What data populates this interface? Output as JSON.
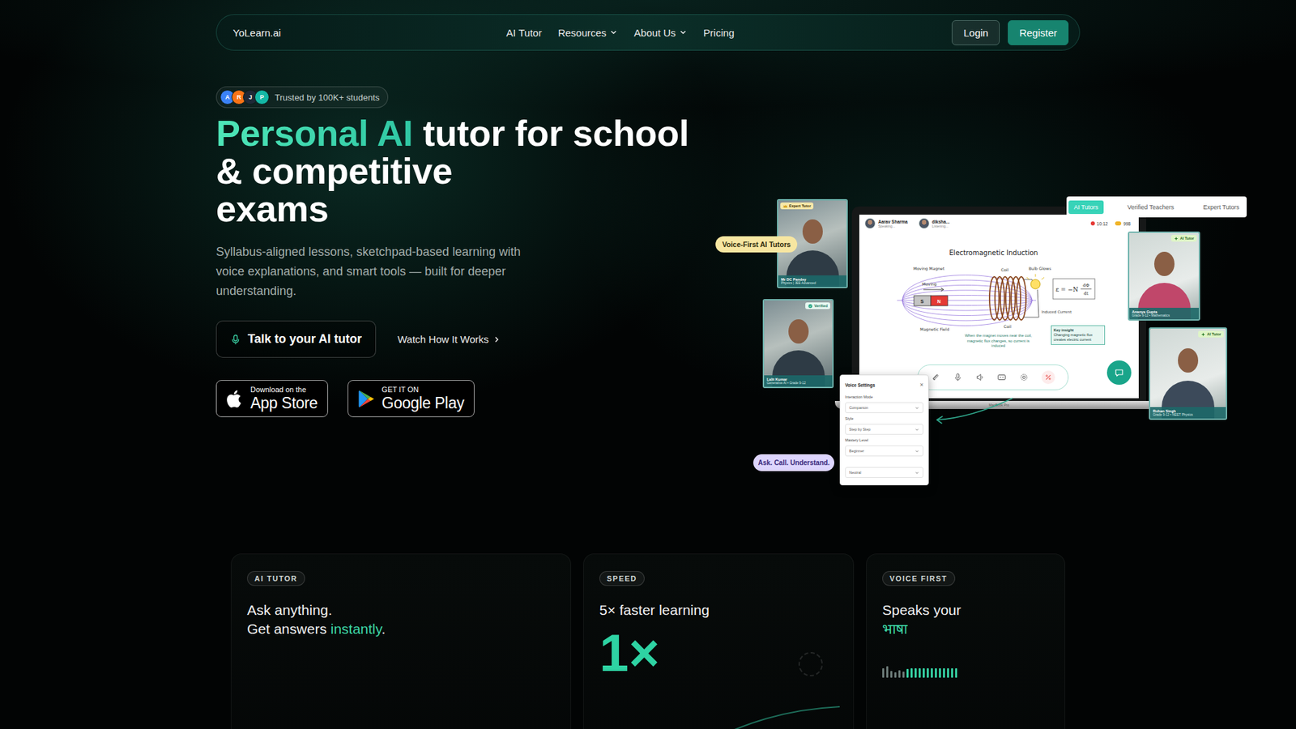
{
  "nav": {
    "logo": "YoLearn.ai",
    "links": [
      {
        "label": "AI Tutor",
        "dropdown": false
      },
      {
        "label": "Resources",
        "dropdown": true
      },
      {
        "label": "About Us",
        "dropdown": true
      },
      {
        "label": "Pricing",
        "dropdown": false
      }
    ],
    "login": "Login",
    "register": "Register"
  },
  "trust": {
    "avatars": [
      {
        "initial": "A",
        "color": "#3b82f6"
      },
      {
        "initial": "R",
        "color": "#f97316"
      },
      {
        "initial": "J",
        "color": "#1f2937"
      },
      {
        "initial": "P",
        "color": "#14b8a6"
      }
    ],
    "text": "Trusted by 100K+ students"
  },
  "hero": {
    "accent": "Personal AI",
    "lines": [
      "tutor for school",
      "& competitive",
      "exams"
    ],
    "subtitle": "Syllabus-aligned lessons, sketchpad-based learning with voice explanations, and smart tools — built for deeper understanding.",
    "primary": "Talk to your AI tutor",
    "secondary": "Watch How It Works"
  },
  "stores": [
    {
      "kind": "apple",
      "small": "Download on the",
      "big": "App Store"
    },
    {
      "kind": "google",
      "small": "GET IT ON",
      "big": "Google Play"
    }
  ],
  "showcase": {
    "voiceLabel": "Voice-First AI Tutors",
    "askLabel": "Ask. Call. Understand.",
    "tabs": [
      {
        "label": "AI Tutors",
        "selected": true
      },
      {
        "label": "Verified Teachers",
        "selected": false
      },
      {
        "label": "Expert Tutors",
        "selected": false
      }
    ],
    "tutors": [
      {
        "name": "Mr DC Pandey",
        "meta": "Physics | JEE Advanced",
        "badge": "Expert Tutor",
        "kind": "expert"
      },
      {
        "name": "Lalit Kumar",
        "meta": "Generative AI • Grade 9-12",
        "badge": "Verified",
        "kind": "verified"
      },
      {
        "name": "Ananya Gupta",
        "meta": "Grade 9-12 • Mathematics",
        "badge": "AI Tutor",
        "kind": "ai"
      },
      {
        "name": "Rohan Singh",
        "meta": "Grade 9-12 • NEET Physics",
        "badge": "AI Tutor",
        "kind": "ai"
      }
    ],
    "call": {
      "participants": [
        {
          "name": "Aarav Sharma",
          "status": "Speaking..."
        },
        {
          "name": "diksha...",
          "status": "Listening..."
        }
      ],
      "time": "10:12",
      "coins": "998"
    },
    "board": {
      "title": "Electromagnetic Induction",
      "movingMagnet": "Moving Magnet",
      "moving": "Moving",
      "south": "S",
      "north": "N",
      "coilTop": "Coil",
      "coilBottom": "Coil",
      "bulb": "Bulb Glows",
      "induced": "Induced Current",
      "field": "Magnetic Field",
      "formula": {
        "lhs": "ε = −N",
        "num": "dΦ",
        "den": "dt"
      },
      "caption": "When the magnet moves near the coil, magnetic flux changes, so current is induced",
      "insightTitle": "Key insight",
      "insight": "Changing magnetic flux creates electric current"
    },
    "laptopBrand": "MacBook Pro",
    "settings": {
      "title": "Voice Settings",
      "close": "×",
      "fields": [
        {
          "label": "Interaction Mode",
          "value": "Companion"
        },
        {
          "label": "Style",
          "value": "Step by Step"
        },
        {
          "label": "Mastery Level",
          "value": "Beginner"
        },
        {
          "value": "Neutral"
        }
      ]
    }
  },
  "features": [
    {
      "tag": "AI TUTOR",
      "kind": "ask",
      "lines": [
        [
          {
            "text": "Ask anything.",
            "accent": false
          }
        ],
        [
          {
            "text": "Get answers ",
            "accent": false
          },
          {
            "text": "instantly",
            "accent": true
          },
          {
            "text": ".",
            "accent": false
          }
        ]
      ]
    },
    {
      "tag": "SPEED",
      "kind": "speed",
      "lines": [
        [
          {
            "text": "5× faster learning",
            "accent": false
          }
        ]
      ],
      "big": "1×"
    },
    {
      "tag": "VOICE FIRST",
      "kind": "voice",
      "lines": [
        [
          {
            "text": "Speaks your",
            "accent": false
          }
        ],
        [
          {
            "text": "भाषा",
            "accent": true
          }
        ]
      ],
      "wave": [
        {
          "level": 0.75,
          "active": false
        },
        {
          "level": 0.95,
          "active": false
        },
        {
          "level": 0.55,
          "active": false
        },
        {
          "level": 0.45,
          "active": false
        },
        {
          "level": 0.6,
          "active": false
        },
        {
          "level": 0.5,
          "active": false
        },
        {
          "level": 0.7,
          "active": true
        },
        {
          "level": 0.75,
          "active": true
        },
        {
          "level": 0.8,
          "active": true
        },
        {
          "level": 0.75,
          "active": true
        },
        {
          "level": 0.8,
          "active": true
        },
        {
          "level": 0.75,
          "active": true
        },
        {
          "level": 0.8,
          "active": true
        },
        {
          "level": 0.8,
          "active": true
        },
        {
          "level": 0.75,
          "active": true
        },
        {
          "level": 0.8,
          "active": true
        },
        {
          "level": 0.8,
          "active": true
        },
        {
          "level": 0.75,
          "active": true
        },
        {
          "level": 0.8,
          "active": true
        }
      ]
    }
  ]
}
